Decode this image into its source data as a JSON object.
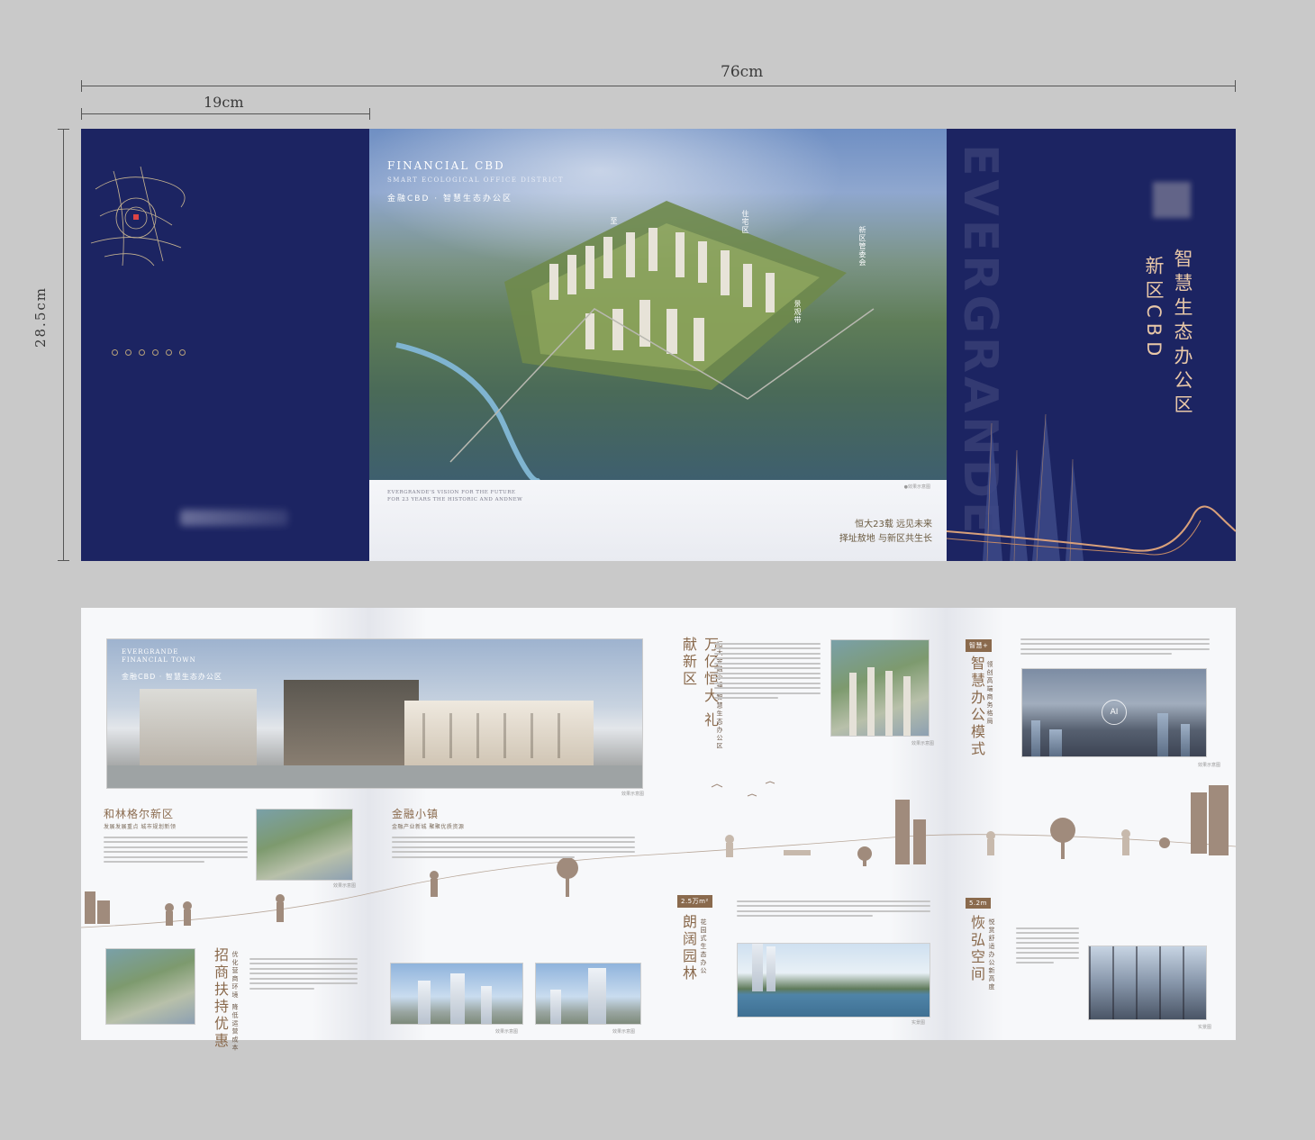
{
  "dimensions": {
    "width_label": "76cm",
    "panel_width_label": "19cm",
    "height_label": "28.5cm"
  },
  "cover": {
    "vertical_brand": "EVERGRANDE",
    "title_line1": "智慧生态办公区",
    "title_line2": "新区CBD"
  },
  "aerial_page": {
    "title_en": "FINANCIAL CBD",
    "subtitle_en": "SMART ECOLOGICAL OFFICE DISTRICT",
    "title_cn": "金融CBD · 智慧生态办公区",
    "tags": [
      "至",
      "住宅区",
      "新区管委会",
      "景观带"
    ],
    "footer_en_line1": "EVERGRANDE'S VISION FOR THE FUTURE",
    "footer_en_line2": "FOR 23 YEARS THE HISTORIC AND ANDNEW",
    "slogan_line1": "恒大23载 远见未来",
    "slogan_line2": "择址敖地 与新区共生长",
    "caption": "●效果示意图"
  },
  "hero_page": {
    "title_en_line1": "EVERGRANDE",
    "title_en_line2": "FINANCIAL TOWN",
    "title_cn": "金融CBD · 智慧生态办公区",
    "caption": "效果示意图"
  },
  "section_horinger": {
    "title": "和林格尔新区",
    "subtitle": "发展发展重点 城市规划新领"
  },
  "section_investment": {
    "title": "招商扶持优惠",
    "subtitle": "优化营商环境 降低运营成本"
  },
  "section_finance_town": {
    "title": "金融小镇",
    "subtitle": "金融产业新城 聚聚优质资源"
  },
  "section_gift": {
    "title": "万亿恒大 礼献新区",
    "subtitle": "恒大金融小镇 智慧生态办公区"
  },
  "section_smart": {
    "badge": "智慧+",
    "title": "智慧办公模式",
    "subtitle": "领创高端商务格局",
    "ai_label": "AI"
  },
  "section_garden": {
    "badge": "2.5万m²",
    "title": "朗阔园林",
    "subtitle": "花园式生态办公"
  },
  "section_space": {
    "badge": "5.2m",
    "title": "恢弘空间",
    "subtitle": "悦赏舒适办公新高度"
  },
  "captions": {
    "photo": "效果示意图",
    "real": "实景图"
  }
}
